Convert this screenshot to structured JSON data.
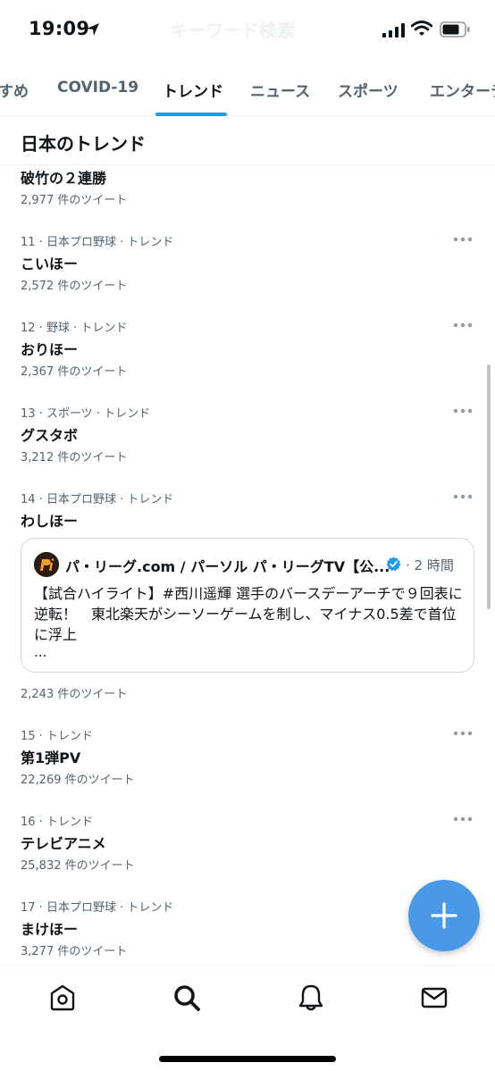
{
  "status": {
    "time": "19:09",
    "behind_search_text": "キーワード検索"
  },
  "tabs": [
    {
      "label": "すめ"
    },
    {
      "label": "COVID-19"
    },
    {
      "label": "トレンド"
    },
    {
      "label": "ニュース"
    },
    {
      "label": "スポーツ"
    },
    {
      "label": "エンターテ"
    }
  ],
  "section": {
    "title": "日本のトレンド"
  },
  "trends": [
    {
      "meta": "",
      "name": "破竹の２連勝",
      "count": "2,977 件のツイート"
    },
    {
      "meta": "11 · 日本プロ野球 · トレンド",
      "name": "こいほー",
      "count": "2,572 件のツイート"
    },
    {
      "meta": "12 · 野球 · トレンド",
      "name": "おりほー",
      "count": "2,367 件のツイート"
    },
    {
      "meta": "13 · スポーツ · トレンド",
      "name": "グスタボ",
      "count": "3,212 件のツイート"
    },
    {
      "meta": "14 · 日本プロ野球 · トレンド",
      "name": "わしほー",
      "count": "2,243 件のツイート"
    },
    {
      "meta": "15 · トレンド",
      "name": "第1弾PV",
      "count": "22,269 件のツイート"
    },
    {
      "meta": "16 · トレンド",
      "name": "テレビアニメ",
      "count": "25,832 件のツイート"
    },
    {
      "meta": "17 · 日本プロ野球 · トレンド",
      "name": "まけほー",
      "count": "3,277 件のツイート"
    }
  ],
  "tweet_card": {
    "author": "パ・リーグ.com / パーソル パ・リーグTV【公...",
    "time": "· 2 時間",
    "text": "【試合ハイライト】#西川遥輝 選手のバースデーアーチで９回表に逆転！　東北楽天がシーソーゲームを制し、マイナス0.5差で首位に浮上",
    "ellipsis": "..."
  },
  "fab": {
    "label": "+"
  },
  "colors": {
    "accent": "#1d9bf0",
    "fab": "#4a99e9",
    "secondary_text": "#536471"
  }
}
